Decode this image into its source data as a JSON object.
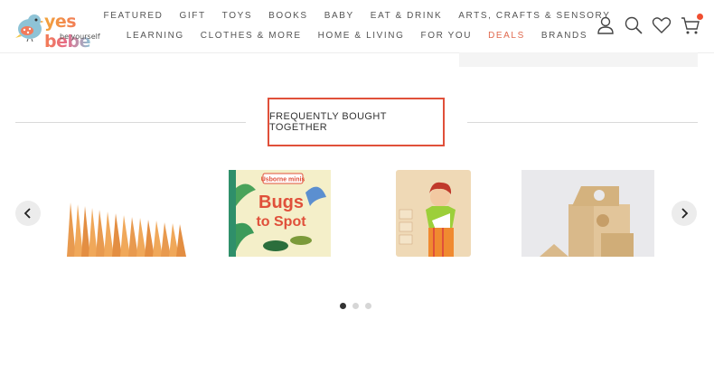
{
  "brand": {
    "name": "yes bebe",
    "tagline": "be yourself"
  },
  "nav": {
    "row1": [
      "FEATURED",
      "GIFT",
      "TOYS",
      "BOOKS",
      "BABY",
      "EAT & DRINK",
      "ARTS, CRAFTS & SENSORY"
    ],
    "row2": [
      "LEARNING",
      "CLOTHES & MORE",
      "HOME & LIVING",
      "FOR YOU",
      "DEALS",
      "BRANDS"
    ]
  },
  "header_icons": [
    "account-icon",
    "search-icon",
    "wishlist-heart-icon",
    "cart-icon"
  ],
  "section": {
    "title": "FREQUENTLY BOUGHT TOGETHER"
  },
  "products": [
    {
      "image": "orange-wooden-cones"
    },
    {
      "image": "bugs-to-spot-book",
      "publisher_label": "Usborne minis",
      "book_title_line1": "Bugs",
      "book_title_line2": "to Spot"
    },
    {
      "image": "dress-up-wooden-puzzle"
    },
    {
      "image": "natural-wooden-blocks"
    }
  ],
  "carousel": {
    "prev": "‹",
    "next": "›",
    "pages": 3,
    "active_page": 1
  },
  "colors": {
    "accent_red": "#e0503a",
    "deals": "#e06a4f",
    "cart_badge": "#f04e30"
  }
}
